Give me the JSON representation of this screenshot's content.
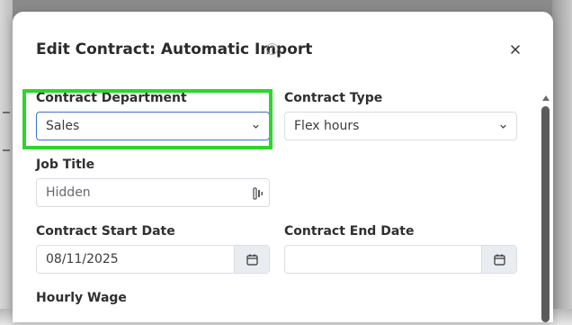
{
  "modal": {
    "title": "Edit Contract: Automatic Import",
    "help_icon": "question-circle-icon",
    "close_icon": "close-icon"
  },
  "form": {
    "contract_department": {
      "label": "Contract Department",
      "value": "Sales"
    },
    "contract_type": {
      "label": "Contract Type",
      "value": "Flex hours"
    },
    "job_title": {
      "label": "Job Title",
      "placeholder": "Hidden",
      "icon": "password-manager-icon"
    },
    "contract_start_date": {
      "label": "Contract Start Date",
      "value": "08/11/2025",
      "icon": "calendar-icon"
    },
    "contract_end_date": {
      "label": "Contract End Date",
      "value": "",
      "icon": "calendar-icon"
    },
    "hourly_wage": {
      "label": "Hourly Wage"
    }
  },
  "colors": {
    "highlight": "#2cd62c",
    "focus_border": "#3c72c6"
  }
}
